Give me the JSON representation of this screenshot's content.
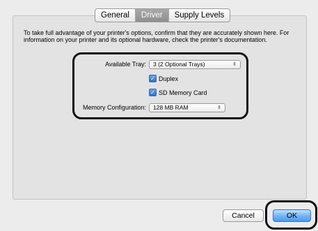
{
  "tabs": [
    {
      "label": "General",
      "selected": false
    },
    {
      "label": "Driver",
      "selected": true
    },
    {
      "label": "Supply Levels",
      "selected": false
    }
  ],
  "description": "To take full advantage of your printer's options, confirm that they are accurately shown here. For information on your printer and its optional hardware, check the printer's documentation.",
  "options": {
    "available_tray": {
      "label": "Available Tray:",
      "value": "3 (2 Optional Trays)"
    },
    "duplex": {
      "label": "Duplex",
      "checked": true
    },
    "sd_card": {
      "label": "SD Memory Card",
      "checked": true
    },
    "memory": {
      "label": "Memory Configuration:",
      "value": "128 MB  RAM"
    }
  },
  "buttons": {
    "cancel": "Cancel",
    "ok": "OK"
  },
  "colors": {
    "accent": "#4d9bf0",
    "highlight_frame": "#111111"
  }
}
